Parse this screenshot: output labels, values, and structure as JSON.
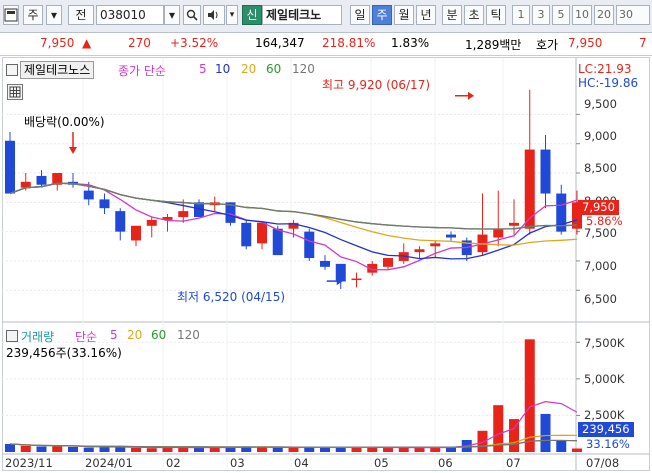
{
  "toolbar": {
    "market_select": "주",
    "type_select": "전",
    "code": "038010",
    "new_badge": "신",
    "stock_name": "제일테크노",
    "periods": [
      "일",
      "주",
      "월",
      "년",
      "분",
      "초",
      "틱"
    ],
    "active_period": "주",
    "numbers": [
      "1",
      "3",
      "5",
      "10",
      "20",
      "30"
    ]
  },
  "quote": {
    "price": "7,950",
    "change": "270",
    "change_pct": "+3.52%",
    "volume": "164,347",
    "volume_ratio": "218.81%",
    "turnover": "1.83%",
    "amount": "1,289백만",
    "ask_label": "호가",
    "ask_price": "7,950",
    "trailing": "7"
  },
  "price_panel": {
    "title": "제일테크노스",
    "ma_label_prefix": "종가 단순",
    "ma_periods": [
      "5",
      "10",
      "20",
      "60",
      "120"
    ],
    "lc_label": "LC:21.93",
    "hc_label": "HC:-19.86",
    "dividend_label": "배당락(0.00%)",
    "high_label": "최고 9,920 (06/17)",
    "low_label": "최저 6,520 (04/15)",
    "current_price_tag": "7,950",
    "current_pct_tag": "5.86%",
    "y_ticks": [
      "9,500",
      "9,000",
      "8,500",
      "8,000",
      "7,500",
      "7,000",
      "6,500"
    ]
  },
  "volume_panel": {
    "title": "거래량",
    "ma_label_prefix": "단순",
    "ma_periods": [
      "5",
      "20",
      "60",
      "120"
    ],
    "current_label": "239,456주(33.16%)",
    "current_tag": "239,456",
    "pct_tag": "33.16%",
    "y_ticks": [
      "7,500K",
      "5,000K",
      "2,500K"
    ]
  },
  "x_axis": [
    "2023/11",
    "2024/01",
    "02",
    "03",
    "04",
    "05",
    "06",
    "07",
    "07/08"
  ],
  "colors": {
    "up": "#e8241a",
    "down": "#1f49d6",
    "ma5": "#d238c8",
    "ma10": "#2233cc",
    "ma20": "#e0a818",
    "ma60": "#2a9a2a",
    "ma120": "#777777"
  },
  "chart_data": [
    {
      "type": "candlestick",
      "title": "제일테크노스",
      "x_unit": "week",
      "ylim": [
        6300,
        9950
      ],
      "y_ticks": [
        6500,
        7000,
        7500,
        8000,
        8500,
        9000,
        9500
      ],
      "candles": [
        {
          "o": 9050,
          "h": 9200,
          "l": 8150,
          "c": 8150
        },
        {
          "o": 8250,
          "h": 8500,
          "l": 8200,
          "c": 8350
        },
        {
          "o": 8450,
          "h": 8550,
          "l": 8250,
          "c": 8300
        },
        {
          "o": 8300,
          "h": 8500,
          "l": 8200,
          "c": 8500
        },
        {
          "o": 8350,
          "h": 8500,
          "l": 8250,
          "c": 8300
        },
        {
          "o": 8200,
          "h": 8350,
          "l": 7950,
          "c": 8050
        },
        {
          "o": 8050,
          "h": 8150,
          "l": 7800,
          "c": 7900
        },
        {
          "o": 7850,
          "h": 7900,
          "l": 7350,
          "c": 7500
        },
        {
          "o": 7350,
          "h": 7600,
          "l": 7250,
          "c": 7600
        },
        {
          "o": 7600,
          "h": 7750,
          "l": 7400,
          "c": 7700
        },
        {
          "o": 7700,
          "h": 7800,
          "l": 7500,
          "c": 7750
        },
        {
          "o": 7750,
          "h": 8050,
          "l": 7650,
          "c": 7850
        },
        {
          "o": 8000,
          "h": 8050,
          "l": 7750,
          "c": 7750
        },
        {
          "o": 7950,
          "h": 8100,
          "l": 7850,
          "c": 8000
        },
        {
          "o": 8000,
          "h": 8000,
          "l": 7600,
          "c": 7650
        },
        {
          "o": 7650,
          "h": 7700,
          "l": 7200,
          "c": 7250
        },
        {
          "o": 7300,
          "h": 7650,
          "l": 7200,
          "c": 7650
        },
        {
          "o": 7550,
          "h": 7600,
          "l": 7100,
          "c": 7100
        },
        {
          "o": 7550,
          "h": 7700,
          "l": 7400,
          "c": 7650
        },
        {
          "o": 7500,
          "h": 7550,
          "l": 7000,
          "c": 7050
        },
        {
          "o": 7000,
          "h": 7100,
          "l": 6850,
          "c": 6900
        },
        {
          "o": 6950,
          "h": 6950,
          "l": 6520,
          "c": 6650
        },
        {
          "o": 6700,
          "h": 6800,
          "l": 6550,
          "c": 6700
        },
        {
          "o": 6800,
          "h": 7000,
          "l": 6750,
          "c": 6950
        },
        {
          "o": 6900,
          "h": 7050,
          "l": 6850,
          "c": 7050
        },
        {
          "o": 7000,
          "h": 7300,
          "l": 6950,
          "c": 7150
        },
        {
          "o": 7150,
          "h": 7250,
          "l": 7050,
          "c": 7200
        },
        {
          "o": 7250,
          "h": 7350,
          "l": 7050,
          "c": 7300
        },
        {
          "o": 7450,
          "h": 7500,
          "l": 7350,
          "c": 7400
        },
        {
          "o": 7350,
          "h": 7400,
          "l": 7000,
          "c": 7100
        },
        {
          "o": 7150,
          "h": 8150,
          "l": 7100,
          "c": 7450
        },
        {
          "o": 7400,
          "h": 8200,
          "l": 7250,
          "c": 7550
        },
        {
          "o": 7600,
          "h": 8050,
          "l": 7450,
          "c": 7650
        },
        {
          "o": 7550,
          "h": 9920,
          "l": 7450,
          "c": 8900
        },
        {
          "o": 8900,
          "h": 9150,
          "l": 7900,
          "c": 8150
        },
        {
          "o": 8150,
          "h": 8300,
          "l": 7450,
          "c": 7500
        },
        {
          "o": 7550,
          "h": 8200,
          "l": 7450,
          "c": 8000
        }
      ]
    },
    {
      "type": "bar",
      "title": "거래량",
      "unit": "K shares",
      "ylim": [
        0,
        8200
      ],
      "y_ticks": [
        2500,
        5000,
        7500
      ],
      "values": [
        550,
        420,
        380,
        390,
        350,
        300,
        320,
        350,
        280,
        260,
        300,
        320,
        340,
        300,
        290,
        380,
        330,
        280,
        300,
        320,
        330,
        370,
        300,
        280,
        270,
        300,
        350,
        330,
        300,
        820,
        1450,
        3200,
        2250,
        7700,
        2600,
        780,
        239
      ]
    }
  ]
}
